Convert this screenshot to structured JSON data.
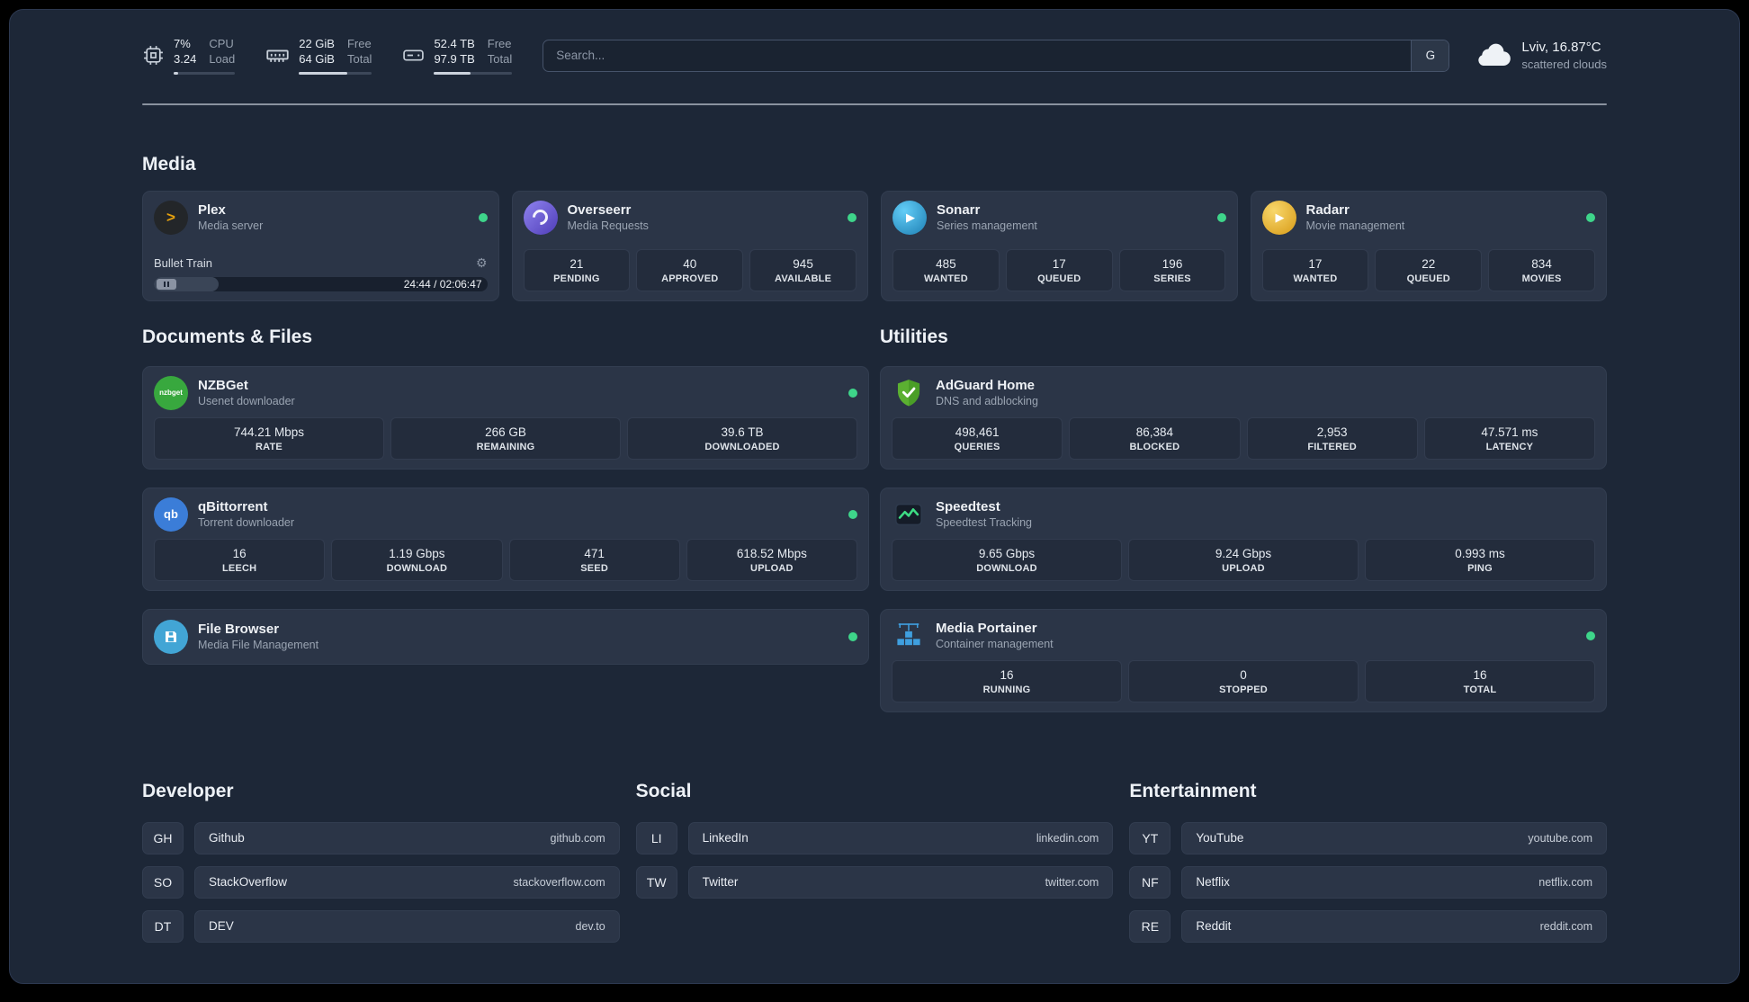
{
  "colors": {
    "status_online": "#3ed58a",
    "accent_plex": "#e5a00d",
    "accent_overseerr": "#6b5bd2",
    "accent_sonarr": "#35c5f4",
    "accent_radarr": "#f4c335",
    "accent_nzbget": "#38a83e",
    "accent_qbittorrent": "#3b7dd8",
    "accent_filebrowser": "#42a5d5",
    "accent_adguard": "#5bb031",
    "accent_speedtest_line": "#3ddc84",
    "accent_portainer": "#3f9fdf"
  },
  "topbar": {
    "cpu": {
      "line1": "7%",
      "line2": "3.24",
      "label1": "CPU",
      "label2": "Load",
      "bar_percent": 7
    },
    "memory": {
      "line1": "22 GiB",
      "line2": "64 GiB",
      "label1": "Free",
      "label2": "Total",
      "bar_percent": 66
    },
    "disk": {
      "line1": "52.4 TB",
      "line2": "97.9 TB",
      "label1": "Free",
      "label2": "Total",
      "bar_percent": 47
    },
    "search": {
      "placeholder": "Search...",
      "button_label": "G"
    },
    "weather": {
      "location": "Lviv, 16.87°C",
      "condition": "scattered clouds"
    }
  },
  "sections": {
    "media": {
      "title": "Media"
    },
    "documents": {
      "title": "Documents & Files"
    },
    "utilities": {
      "title": "Utilities"
    },
    "developer": {
      "title": "Developer"
    },
    "social": {
      "title": "Social"
    },
    "entertainment": {
      "title": "Entertainment"
    }
  },
  "media_services": [
    {
      "name": "Plex",
      "subtitle": "Media server",
      "online": true,
      "player": {
        "track": "Bullet Train",
        "time": "24:44 / 02:06:47",
        "progress_percent": 19.5
      }
    },
    {
      "name": "Overseerr",
      "subtitle": "Media Requests",
      "online": true,
      "stats": [
        {
          "value": "21",
          "label": "PENDING"
        },
        {
          "value": "40",
          "label": "APPROVED"
        },
        {
          "value": "945",
          "label": "AVAILABLE"
        }
      ]
    },
    {
      "name": "Sonarr",
      "subtitle": "Series management",
      "online": true,
      "stats": [
        {
          "value": "485",
          "label": "WANTED"
        },
        {
          "value": "17",
          "label": "QUEUED"
        },
        {
          "value": "196",
          "label": "SERIES"
        }
      ]
    },
    {
      "name": "Radarr",
      "subtitle": "Movie management",
      "online": true,
      "stats": [
        {
          "value": "17",
          "label": "WANTED"
        },
        {
          "value": "22",
          "label": "QUEUED"
        },
        {
          "value": "834",
          "label": "MOVIES"
        }
      ]
    }
  ],
  "document_services": [
    {
      "name": "NZBGet",
      "subtitle": "Usenet downloader",
      "online": true,
      "icon_text": "nzbget",
      "stats": [
        {
          "value": "744.21 Mbps",
          "label": "RATE"
        },
        {
          "value": "266 GB",
          "label": "REMAINING"
        },
        {
          "value": "39.6 TB",
          "label": "DOWNLOADED"
        }
      ]
    },
    {
      "name": "qBittorrent",
      "subtitle": "Torrent downloader",
      "online": true,
      "icon_text": "qb",
      "stats": [
        {
          "value": "16",
          "label": "LEECH"
        },
        {
          "value": "1.19 Gbps",
          "label": "DOWNLOAD"
        },
        {
          "value": "471",
          "label": "SEED"
        },
        {
          "value": "618.52 Mbps",
          "label": "UPLOAD"
        }
      ]
    },
    {
      "name": "File Browser",
      "subtitle": "Media File Management",
      "online": true
    }
  ],
  "utility_services": [
    {
      "name": "AdGuard Home",
      "subtitle": "DNS and adblocking",
      "stats": [
        {
          "value": "498,461",
          "label": "QUERIES"
        },
        {
          "value": "86,384",
          "label": "BLOCKED"
        },
        {
          "value": "2,953",
          "label": "FILTERED"
        },
        {
          "value": "47.571 ms",
          "label": "LATENCY"
        }
      ]
    },
    {
      "name": "Speedtest",
      "subtitle": "Speedtest Tracking",
      "stats": [
        {
          "value": "9.65 Gbps",
          "label": "DOWNLOAD"
        },
        {
          "value": "9.24 Gbps",
          "label": "UPLOAD"
        },
        {
          "value": "0.993 ms",
          "label": "PING"
        }
      ]
    },
    {
      "name": "Media Portainer",
      "subtitle": "Container management",
      "online": true,
      "stats": [
        {
          "value": "16",
          "label": "RUNNING"
        },
        {
          "value": "0",
          "label": "STOPPED"
        },
        {
          "value": "16",
          "label": "TOTAL"
        }
      ]
    }
  ],
  "bookmarks": {
    "developer": [
      {
        "abbr": "GH",
        "name": "Github",
        "url": "github.com"
      },
      {
        "abbr": "SO",
        "name": "StackOverflow",
        "url": "stackoverflow.com"
      },
      {
        "abbr": "DT",
        "name": "DEV",
        "url": "dev.to"
      }
    ],
    "social": [
      {
        "abbr": "LI",
        "name": "LinkedIn",
        "url": "linkedin.com"
      },
      {
        "abbr": "TW",
        "name": "Twitter",
        "url": "twitter.com"
      }
    ],
    "entertainment": [
      {
        "abbr": "YT",
        "name": "YouTube",
        "url": "youtube.com"
      },
      {
        "abbr": "NF",
        "name": "Netflix",
        "url": "netflix.com"
      },
      {
        "abbr": "RE",
        "name": "Reddit",
        "url": "reddit.com"
      }
    ]
  }
}
